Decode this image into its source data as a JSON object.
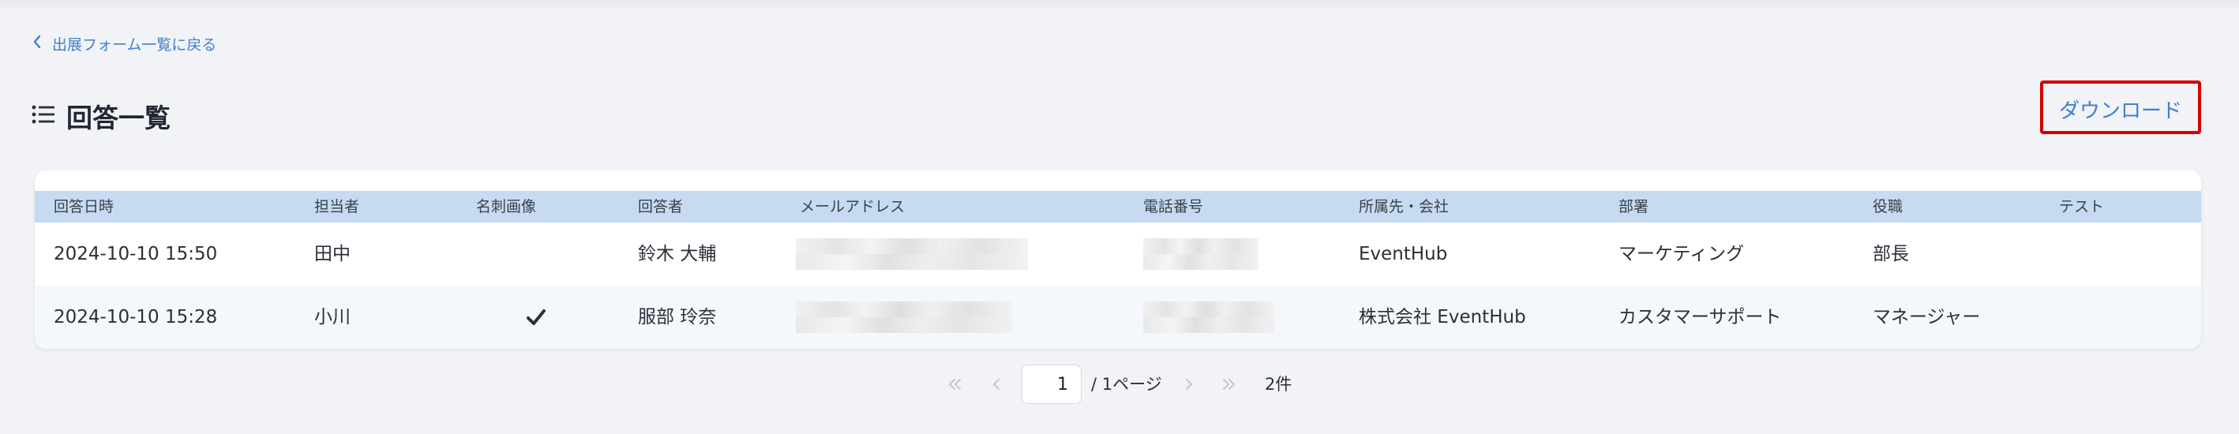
{
  "back_link": {
    "label": "出展フォーム一覧に戻る"
  },
  "page": {
    "title": "回答一覧"
  },
  "toolbar": {
    "download_label": "ダウンロード"
  },
  "table": {
    "columns": [
      "回答日時",
      "担当者",
      "名刺画像",
      "回答者",
      "メールアドレス",
      "電話番号",
      "所属先・会社",
      "部署",
      "役職",
      "テスト"
    ],
    "rows": [
      {
        "datetime": "2024-10-10 15:50",
        "staff": "田中",
        "card_image": "",
        "respondent": "鈴木 大輔",
        "company": "EventHub",
        "department": "マーケティング",
        "position": "部長",
        "test": ""
      },
      {
        "datetime": "2024-10-10 15:28",
        "staff": "小川",
        "card_image": "check-icon",
        "respondent": "服部 玲奈",
        "company": "株式会社 EventHub",
        "department": "カスタマーサポート",
        "position": "マネージャー",
        "test": ""
      }
    ]
  },
  "pagination": {
    "current_page": "1",
    "of_pages": "/ 1ページ",
    "total": "2件",
    "icons": [
      "first-page-icon",
      "prev-page-icon",
      "next-page-icon",
      "last-page-icon"
    ]
  },
  "colors": {
    "link": "#3f7fd0",
    "header_bg": "#c6dbf1",
    "highlight_border": "#d50000",
    "page_bg": "#f2f3f6"
  }
}
